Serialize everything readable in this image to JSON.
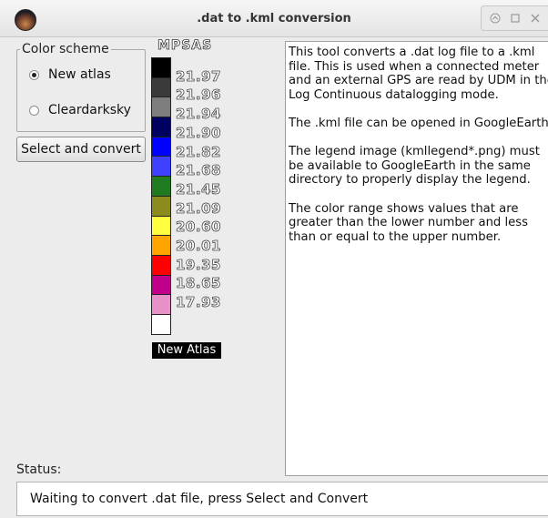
{
  "window": {
    "title": ".dat to .kml conversion",
    "controls": [
      "minimize-icon",
      "maximize-icon",
      "close-icon"
    ]
  },
  "color_scheme": {
    "label": "Color scheme",
    "options": [
      {
        "label": "New atlas",
        "checked": true
      },
      {
        "label": "Cleardarksky",
        "checked": false
      }
    ]
  },
  "actions": {
    "select_convert_label": "Select and convert"
  },
  "legend": {
    "unit": "MPSAS",
    "caption": "New Atlas",
    "colors": [
      "#000000",
      "#3a3a3a",
      "#7d7d7d",
      "#000060",
      "#0000ff",
      "#4040ff",
      "#207a20",
      "#8c8c1e",
      "#ffff40",
      "#ffa500",
      "#ff0000",
      "#c0008a",
      "#e890c8",
      "#ffffff"
    ],
    "values": [
      "21.97",
      "21.96",
      "21.94",
      "21.90",
      "21.82",
      "21.68",
      "21.45",
      "21.09",
      "20.60",
      "20.01",
      "19.35",
      "18.65",
      "17.93"
    ]
  },
  "info": {
    "paragraphs": [
      "This tool converts a .dat log file to a .kml file. This is used when a connected meter and an external GPS are read by UDM in the Log Continuous datalogging mode.",
      "The .kml file can be opened in GoogleEarth.",
      "The legend image (kmllegend*.png) must be available to GoogleEarth in the same directory to properly display the legend.",
      "The color range shows values that are greater than the lower number and less than or equal to the upper number."
    ]
  },
  "status": {
    "label": "Status:",
    "message": "Waiting to convert .dat file, press Select and Convert"
  }
}
